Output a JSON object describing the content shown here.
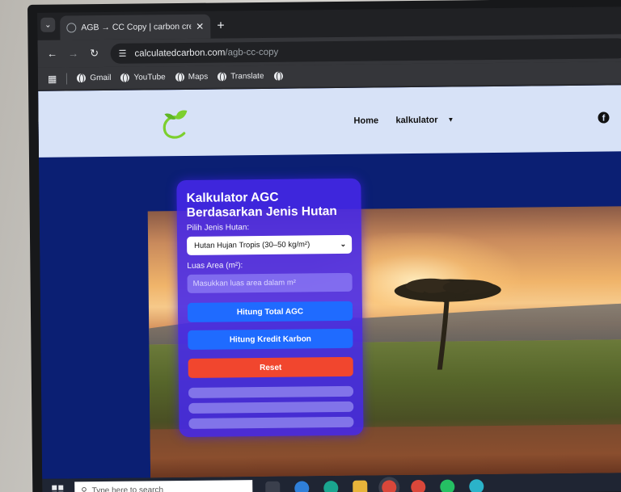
{
  "browser": {
    "tab_title": "AGB → CC Copy | carbon credit",
    "tab_close": "✕",
    "new_tab": "+",
    "url_domain": "calculatedcarbon.com",
    "url_path": "/agb-cc-copy",
    "bookmarks": [
      {
        "label": "Gmail",
        "icon": "globe-icon"
      },
      {
        "label": "YouTube",
        "icon": "globe-icon"
      },
      {
        "label": "Maps",
        "icon": "globe-icon"
      },
      {
        "label": "Translate",
        "icon": "globe-icon"
      },
      {
        "label": "",
        "icon": "globe-icon"
      }
    ]
  },
  "site": {
    "nav": {
      "home": "Home",
      "kalkulator": "kalkulator",
      "caret": "▼",
      "facebook_glyph": "f"
    },
    "calculator": {
      "title": "Kalkulator AGC Berdasarkan Jenis Hutan",
      "forest_label": "Pilih Jenis Hutan:",
      "forest_selected": "Hutan Hujan Tropis (30–50 kg/m²)",
      "area_label": "Luas Area (m²):",
      "area_placeholder": "Masukkan luas area dalam m²",
      "btn_total": "Hitung Total AGC",
      "btn_credit": "Hitung Kredit Karbon",
      "btn_reset": "Reset"
    }
  },
  "taskbar": {
    "search_placeholder": "Type here to search"
  },
  "colors": {
    "page_bg": "#0b1f73",
    "header_bg": "#d7e2f7",
    "card": "#4628eb",
    "btn_blue": "#1f6bff",
    "btn_red": "#f1462e"
  }
}
